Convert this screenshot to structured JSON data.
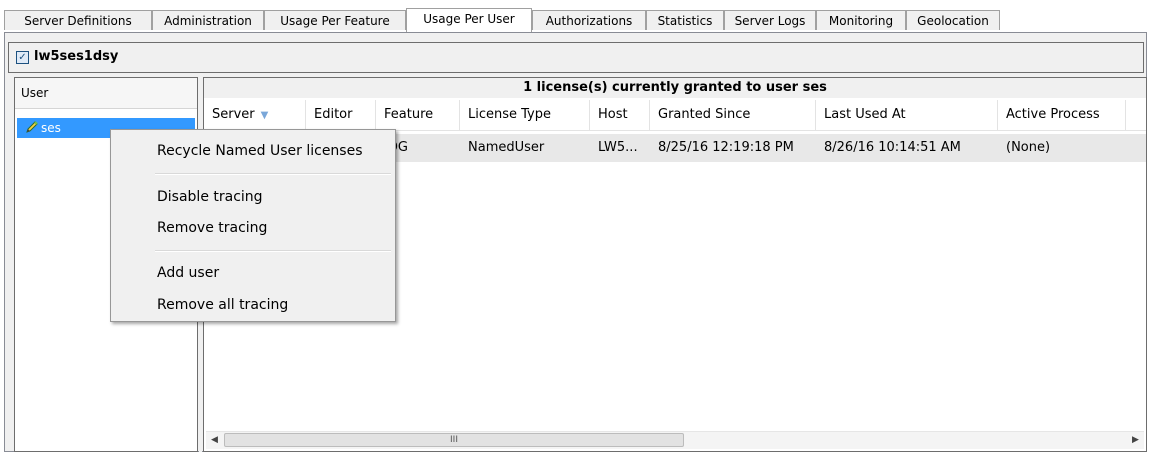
{
  "tabs": [
    {
      "label": "Server Definitions",
      "active": false
    },
    {
      "label": "Administration",
      "active": false
    },
    {
      "label": "Usage Per Feature",
      "active": false
    },
    {
      "label": "Usage Per User",
      "active": true
    },
    {
      "label": "Authorizations",
      "active": false
    },
    {
      "label": "Statistics",
      "active": false
    },
    {
      "label": "Server Logs",
      "active": false
    },
    {
      "label": "Monitoring",
      "active": false
    },
    {
      "label": "Geolocation",
      "active": false
    }
  ],
  "server": {
    "checked": true,
    "check_glyph": "✓",
    "name": "lw5ses1dsy"
  },
  "user_pane": {
    "header": "User",
    "users": [
      {
        "name": "ses",
        "icon": "pencil-icon",
        "selected": true
      }
    ]
  },
  "grid": {
    "title": "1 license(s) currently granted to user ses",
    "columns": [
      "Server",
      "Editor",
      "Feature",
      "License Type",
      "Host",
      "Granted Since",
      "Last Used At",
      "Active Process"
    ],
    "sort_column": "Server",
    "sort_glyph": "▼",
    "rows": [
      [
        "",
        "",
        "IDG",
        "NamedUser",
        "LW5...",
        "8/25/16 12:19:18 PM",
        "8/26/16 10:14:51 AM",
        "(None)"
      ]
    ]
  },
  "scrollbar": {
    "left_glyph": "◀",
    "right_glyph": "▶",
    "thumb_grip": "III"
  },
  "context_menu": {
    "items": [
      {
        "label": "Recycle Named User licenses"
      },
      {
        "label": "Disable tracing"
      },
      {
        "label": "Remove tracing"
      },
      {
        "label": "Add user"
      },
      {
        "label": "Remove all tracing"
      }
    ]
  },
  "colors": {
    "selection": "#3399ff",
    "panel_bg": "#f0f0f0"
  }
}
